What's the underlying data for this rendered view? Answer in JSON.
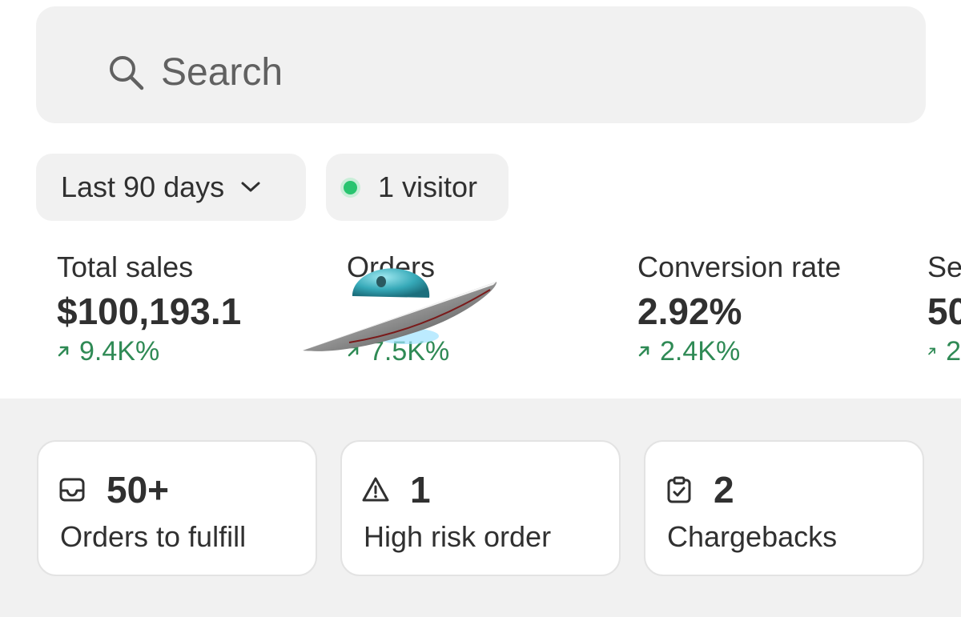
{
  "search": {
    "placeholder": "Search",
    "icon": "search-icon"
  },
  "filters": {
    "period_label": "Last 90 days",
    "visitors_label": "1 visitor",
    "live_dot_color": "#29c46f"
  },
  "metrics": [
    {
      "label": "Total sales",
      "value": "$100,193.1",
      "delta": "9.4K%"
    },
    {
      "label": "Orders",
      "value": "",
      "delta": "7.5K%"
    },
    {
      "label": "Conversion rate",
      "value": "2.92%",
      "delta": "2.4K%"
    },
    {
      "label": "Se",
      "value": "50",
      "delta": "2"
    }
  ],
  "cards": [
    {
      "icon": "inbox-icon",
      "count": "50+",
      "label": "Orders to fulfill"
    },
    {
      "icon": "alert-triangle-icon",
      "count": "1",
      "label": "High risk order"
    },
    {
      "icon": "clipboard-check-icon",
      "count": "2",
      "label": "Chargebacks"
    }
  ],
  "colors": {
    "positive_delta": "#2f8a55",
    "panel_background": "#f1f1f1"
  }
}
